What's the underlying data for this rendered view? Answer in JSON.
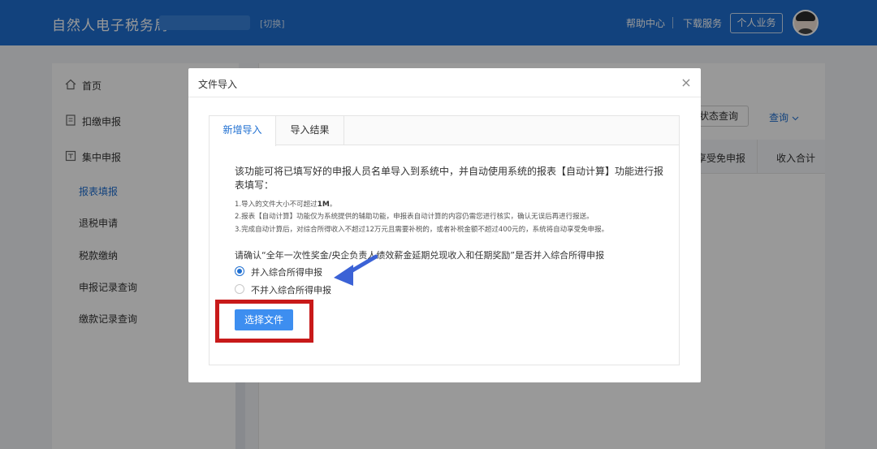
{
  "header": {
    "app_title": "自然人电子税务局",
    "switch_label": "[切换]",
    "help_label": "帮助中心",
    "download_label": "下载服务",
    "personal_label": "个人业务"
  },
  "sidebar": {
    "items": [
      {
        "label": "首页",
        "icon": "home-icon"
      },
      {
        "label": "扣缴申报",
        "icon": "document-icon"
      },
      {
        "label": "集中申报",
        "icon": "report-icon"
      }
    ],
    "sub_items": [
      "报表填报",
      "退税申请",
      "税款缴纳",
      "申报记录查询",
      "缴款记录查询"
    ],
    "active_sub": "报表填报"
  },
  "main": {
    "status_query_label": "状态查询",
    "query_label": "查询",
    "col_header_1": "享受免申报",
    "col_header_2": "收入合计"
  },
  "modal": {
    "title": "文件导入",
    "close_symbol": "×",
    "tabs": [
      "新增导入",
      "导入结果"
    ],
    "description": "该功能可将已填写好的申报人员名单导入到系统中，并自动使用系统的报表【自动计算】功能进行报表填写：",
    "note_1_prefix": "1.导入的文件大小不可超过",
    "note_1_bold": "1M",
    "note_1_suffix": "。",
    "note_2": "2.报表【自动计算】功能仅为系统提供的辅助功能，申报表自动计算的内容仍需您进行核实，确认无误后再进行报送。",
    "note_3": "3.完成自动计算后，对综合所得收入不超过12万元且需要补税的，或者补税金额不超过400元的，系统将自动享受免申报。",
    "confirm_question": "请确认“全年一次性奖金/央企负责人绩效薪金延期兑现收入和任期奖励”是否并入综合所得申报",
    "options": [
      "并入综合所得申报",
      "不并入综合所得申报"
    ],
    "selected_option": 0,
    "choose_file_label": "选择文件"
  },
  "colors": {
    "header_blue": "#1f6fd1",
    "button_blue": "#3d8ef0",
    "highlight_red": "#c81a1a",
    "arrow_blue": "#3b62d6"
  }
}
